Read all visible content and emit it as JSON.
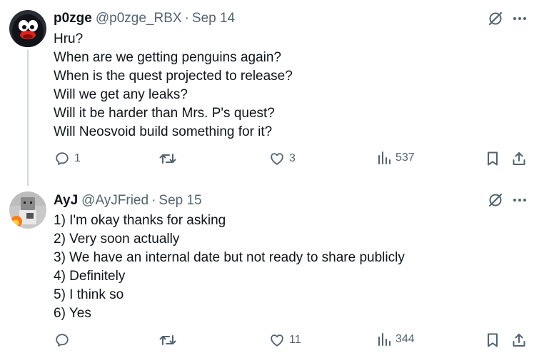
{
  "tweets": [
    {
      "name": "p0zge",
      "handle": "@p0zge_RBX",
      "separator": "·",
      "date": "Sep 14",
      "lines": [
        "Hru?",
        "When are we getting penguins again?",
        "When is the quest projected to release?",
        "Will we get any leaks?",
        "Will it be harder than Mrs. P's quest?",
        "Will Neosvoid build something for it?"
      ],
      "replies": "1",
      "retweets": "",
      "likes": "3",
      "views": "537"
    },
    {
      "name": "AyJ",
      "handle": "@AyJFried",
      "separator": "·",
      "date": "Sep 15",
      "lines": [
        "1) I'm okay thanks for asking",
        "2) Very soon actually",
        "3) We have an internal date but not ready to share publicly",
        "4) Definitely",
        "5) I think so",
        "6) Yes"
      ],
      "replies": "",
      "retweets": "",
      "likes": "11",
      "views": "344"
    }
  ],
  "colors": {
    "text": "#0f1419",
    "secondary": "#536471",
    "thread_line": "#cfd9de"
  },
  "icons": [
    "grok-icon",
    "more-icon",
    "reply-icon",
    "retweet-icon",
    "like-icon",
    "views-icon",
    "bookmark-icon",
    "share-icon"
  ]
}
